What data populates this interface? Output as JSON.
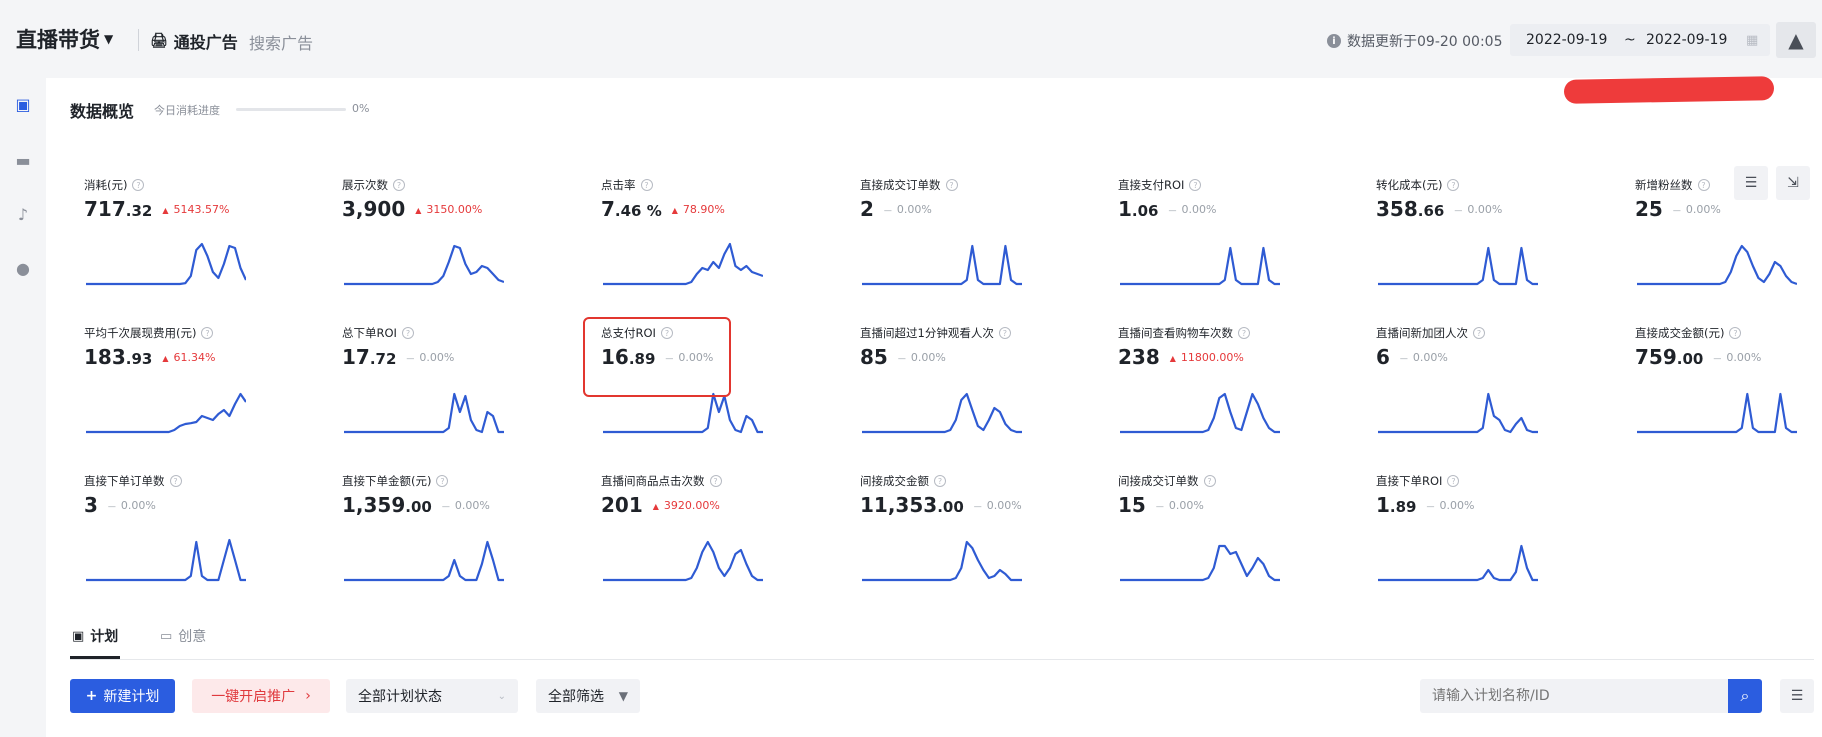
{
  "header": {
    "brand": "直播带货",
    "nav_active": "通投广告",
    "nav_inactive": "搜索广告",
    "updated": "数据更新于09-20 00:05",
    "date_start": "2022-09-19",
    "date_sep": "~",
    "date_end": "2022-09-19"
  },
  "overview": {
    "title": "数据概览",
    "progress_label": "今日消耗进度",
    "progress_value": "0%"
  },
  "metrics": [
    {
      "label": "消耗(元)",
      "int": "717",
      "dec": ".32",
      "arrow": "▲",
      "change": "5143.57%",
      "trend": "up",
      "spark": [
        0,
        0,
        0,
        0,
        0,
        0,
        0,
        0,
        0,
        0,
        0,
        0,
        0,
        0,
        0,
        0,
        0,
        0,
        0.02,
        0.2,
        0.85,
        1,
        0.7,
        0.3,
        0.15,
        0.5,
        0.95,
        0.9,
        0.4,
        0.1
      ]
    },
    {
      "label": "展示次数",
      "int": "3,900",
      "dec": "",
      "arrow": "▲",
      "change": "3150.00%",
      "trend": "up",
      "spark": [
        0,
        0,
        0,
        0,
        0,
        0,
        0,
        0,
        0,
        0,
        0,
        0,
        0,
        0,
        0,
        0,
        0,
        0.05,
        0.2,
        0.55,
        0.95,
        0.9,
        0.5,
        0.25,
        0.3,
        0.45,
        0.4,
        0.25,
        0.1,
        0.05
      ]
    },
    {
      "label": "点击率",
      "int": "7",
      "dec": ".46 %",
      "arrow": "▲",
      "change": "78.90%",
      "trend": "up",
      "spark": [
        0,
        0,
        0,
        0,
        0,
        0,
        0,
        0,
        0,
        0,
        0,
        0,
        0,
        0,
        0,
        0,
        0.05,
        0.25,
        0.4,
        0.35,
        0.55,
        0.4,
        0.75,
        1,
        0.45,
        0.35,
        0.45,
        0.3,
        0.25,
        0.2
      ]
    },
    {
      "label": "直接成交订单数",
      "int": "2",
      "dec": "",
      "arrow": "—",
      "change": "0.00%",
      "trend": "flat",
      "spark": [
        0,
        0,
        0,
        0,
        0,
        0,
        0,
        0,
        0,
        0,
        0,
        0,
        0,
        0,
        0,
        0,
        0,
        0,
        0,
        0.1,
        0.95,
        0.1,
        0,
        0,
        0,
        0,
        0.95,
        0.1,
        0,
        0
      ]
    },
    {
      "label": "直接支付ROI",
      "int": "1",
      "dec": ".06",
      "arrow": "—",
      "change": "0.00%",
      "trend": "flat",
      "spark": [
        0,
        0,
        0,
        0,
        0,
        0,
        0,
        0,
        0,
        0,
        0,
        0,
        0,
        0,
        0,
        0,
        0,
        0,
        0,
        0.1,
        0.9,
        0.1,
        0,
        0,
        0,
        0,
        0.9,
        0.1,
        0,
        0
      ]
    },
    {
      "label": "转化成本(元)",
      "int": "358",
      "dec": ".66",
      "arrow": "—",
      "change": "0.00%",
      "trend": "flat",
      "spark": [
        0,
        0,
        0,
        0,
        0,
        0,
        0,
        0,
        0,
        0,
        0,
        0,
        0,
        0,
        0,
        0,
        0,
        0,
        0,
        0.1,
        0.9,
        0.1,
        0,
        0,
        0,
        0,
        0.9,
        0.1,
        0,
        0
      ]
    },
    {
      "label": "新增粉丝数",
      "int": "25",
      "dec": "",
      "arrow": "—",
      "change": "0.00%",
      "trend": "flat",
      "spark": [
        0,
        0,
        0,
        0,
        0,
        0,
        0,
        0,
        0,
        0,
        0,
        0,
        0,
        0,
        0,
        0,
        0.05,
        0.3,
        0.7,
        0.95,
        0.8,
        0.45,
        0.15,
        0.05,
        0.25,
        0.55,
        0.45,
        0.2,
        0.05,
        0
      ]
    },
    {
      "label": "平均千次展现费用(元)",
      "int": "183",
      "dec": ".93",
      "arrow": "▲",
      "change": "61.34%",
      "trend": "up",
      "spark": [
        0,
        0,
        0,
        0,
        0,
        0,
        0,
        0,
        0,
        0,
        0,
        0,
        0,
        0,
        0,
        0,
        0.05,
        0.15,
        0.2,
        0.22,
        0.25,
        0.4,
        0.35,
        0.3,
        0.45,
        0.55,
        0.4,
        0.7,
        0.95,
        0.75
      ]
    },
    {
      "label": "总下单ROI",
      "int": "17",
      "dec": ".72",
      "arrow": "—",
      "change": "0.00%",
      "trend": "flat",
      "spark": [
        0,
        0,
        0,
        0,
        0,
        0,
        0,
        0,
        0,
        0,
        0,
        0,
        0,
        0,
        0,
        0,
        0,
        0,
        0,
        0.1,
        0.95,
        0.5,
        0.9,
        0.3,
        0.05,
        0,
        0.5,
        0.4,
        0,
        0
      ]
    },
    {
      "label": "总支付ROI",
      "int": "16",
      "dec": ".89",
      "arrow": "—",
      "change": "0.00%",
      "trend": "flat",
      "spark": [
        0,
        0,
        0,
        0,
        0,
        0,
        0,
        0,
        0,
        0,
        0,
        0,
        0,
        0,
        0,
        0,
        0,
        0,
        0,
        0.1,
        0.95,
        0.5,
        0.9,
        0.3,
        0.05,
        0,
        0.4,
        0.3,
        0,
        0
      ]
    },
    {
      "label": "直播间超过1分钟观看人次",
      "int": "85",
      "dec": "",
      "arrow": "—",
      "change": "0.00%",
      "trend": "flat",
      "spark": [
        0,
        0,
        0,
        0,
        0,
        0,
        0,
        0,
        0,
        0,
        0,
        0,
        0,
        0,
        0,
        0,
        0.05,
        0.3,
        0.8,
        0.95,
        0.55,
        0.15,
        0.05,
        0.3,
        0.6,
        0.5,
        0.2,
        0.05,
        0,
        0
      ]
    },
    {
      "label": "直播间查看购物车次数",
      "int": "238",
      "dec": "",
      "arrow": "▲",
      "change": "11800.00%",
      "trend": "up",
      "spark": [
        0,
        0,
        0,
        0,
        0,
        0,
        0,
        0,
        0,
        0,
        0,
        0,
        0,
        0,
        0,
        0,
        0.05,
        0.35,
        0.85,
        0.95,
        0.5,
        0.1,
        0.05,
        0.5,
        0.95,
        0.7,
        0.35,
        0.1,
        0,
        0
      ]
    },
    {
      "label": "直播间新加团人次",
      "int": "6",
      "dec": "",
      "arrow": "—",
      "change": "0.00%",
      "trend": "flat",
      "spark": [
        0,
        0,
        0,
        0,
        0,
        0,
        0,
        0,
        0,
        0,
        0,
        0,
        0,
        0,
        0,
        0,
        0,
        0,
        0,
        0.1,
        0.95,
        0.4,
        0.3,
        0.05,
        0,
        0.2,
        0.35,
        0.05,
        0,
        0
      ]
    },
    {
      "label": "直接成交金额(元)",
      "int": "759",
      "dec": ".00",
      "arrow": "—",
      "change": "0.00%",
      "trend": "flat",
      "spark": [
        0,
        0,
        0,
        0,
        0,
        0,
        0,
        0,
        0,
        0,
        0,
        0,
        0,
        0,
        0,
        0,
        0,
        0,
        0,
        0.1,
        0.95,
        0.1,
        0,
        0,
        0,
        0,
        0.95,
        0.1,
        0,
        0
      ]
    },
    {
      "label": "直接下单订单数",
      "int": "3",
      "dec": "",
      "arrow": "—",
      "change": "0.00%",
      "trend": "flat",
      "spark": [
        0,
        0,
        0,
        0,
        0,
        0,
        0,
        0,
        0,
        0,
        0,
        0,
        0,
        0,
        0,
        0,
        0,
        0,
        0,
        0.1,
        0.95,
        0.1,
        0,
        0,
        0,
        0.5,
        1,
        0.5,
        0,
        0
      ]
    },
    {
      "label": "直接下单金额(元)",
      "int": "1,359",
      "dec": ".00",
      "arrow": "—",
      "change": "0.00%",
      "trend": "flat",
      "spark": [
        0,
        0,
        0,
        0,
        0,
        0,
        0,
        0,
        0,
        0,
        0,
        0,
        0,
        0,
        0,
        0,
        0,
        0,
        0,
        0.1,
        0.5,
        0.1,
        0,
        0,
        0,
        0.4,
        0.95,
        0.5,
        0,
        0
      ]
    },
    {
      "label": "直播间商品点击次数",
      "int": "201",
      "dec": "",
      "arrow": "▲",
      "change": "3920.00%",
      "trend": "up",
      "spark": [
        0,
        0,
        0,
        0,
        0,
        0,
        0,
        0,
        0,
        0,
        0,
        0,
        0,
        0,
        0,
        0,
        0.05,
        0.3,
        0.7,
        0.95,
        0.7,
        0.3,
        0.1,
        0.3,
        0.65,
        0.75,
        0.4,
        0.1,
        0,
        0
      ]
    },
    {
      "label": "间接成交金额",
      "int": "11,353",
      "dec": ".00",
      "arrow": "—",
      "change": "0.00%",
      "trend": "flat",
      "spark": [
        0,
        0,
        0,
        0,
        0,
        0,
        0,
        0,
        0,
        0,
        0,
        0,
        0,
        0,
        0,
        0,
        0,
        0.05,
        0.3,
        0.95,
        0.8,
        0.5,
        0.25,
        0.05,
        0.1,
        0.25,
        0.15,
        0,
        0,
        0
      ]
    },
    {
      "label": "间接成交订单数",
      "int": "15",
      "dec": "",
      "arrow": "—",
      "change": "0.00%",
      "trend": "flat",
      "spark": [
        0,
        0,
        0,
        0,
        0,
        0,
        0,
        0,
        0,
        0,
        0,
        0,
        0,
        0,
        0,
        0,
        0.05,
        0.3,
        0.85,
        0.85,
        0.65,
        0.7,
        0.4,
        0.1,
        0.3,
        0.55,
        0.4,
        0.1,
        0,
        0
      ]
    },
    {
      "label": "直接下单ROI",
      "int": "1",
      "dec": ".89",
      "arrow": "—",
      "change": "0.00%",
      "trend": "flat",
      "spark": [
        0,
        0,
        0,
        0,
        0,
        0,
        0,
        0,
        0,
        0,
        0,
        0,
        0,
        0,
        0,
        0,
        0,
        0,
        0,
        0.05,
        0.25,
        0.05,
        0,
        0,
        0,
        0.2,
        0.85,
        0.3,
        0,
        0
      ]
    }
  ],
  "tabs": {
    "plan": "计划",
    "creative": "创意"
  },
  "toolbar": {
    "new_plan": "新建计划",
    "launch": "一键开启推广",
    "status_select": "全部计划状态",
    "filter": "全部筛选",
    "search_placeholder": "请输入计划名称/ID"
  },
  "colors": {
    "accent": "#2b5de0",
    "up": "#e5393b",
    "spark": "#2f5bd3",
    "highlight": "#e2362f"
  },
  "icons": [
    "bell-icon",
    "calendar-icon",
    "info-icon",
    "overview-icon",
    "folder-icon",
    "tiktok-icon",
    "user-icon",
    "search-icon",
    "filter-icon",
    "settings-icon",
    "collapse-icon"
  ]
}
